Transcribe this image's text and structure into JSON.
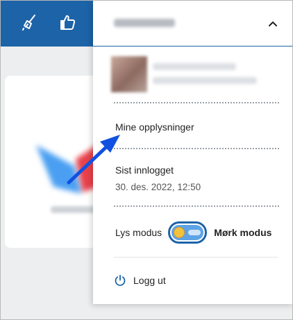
{
  "colors": {
    "brand": "#1d63a8",
    "toggle_track": "#5ea3e6",
    "sun": "#f2c13e",
    "arrow": "#1151e0"
  },
  "appbar": {
    "icons": [
      "broom-icon",
      "thumbs-up-icon"
    ]
  },
  "menu": {
    "my_info": "Mine opplysninger",
    "last_login_label": "Sist innlogget",
    "last_login_value": "30. des. 2022, 12:50",
    "light_mode": "Lys modus",
    "dark_mode": "Mørk modus",
    "logout": "Logg ut"
  }
}
